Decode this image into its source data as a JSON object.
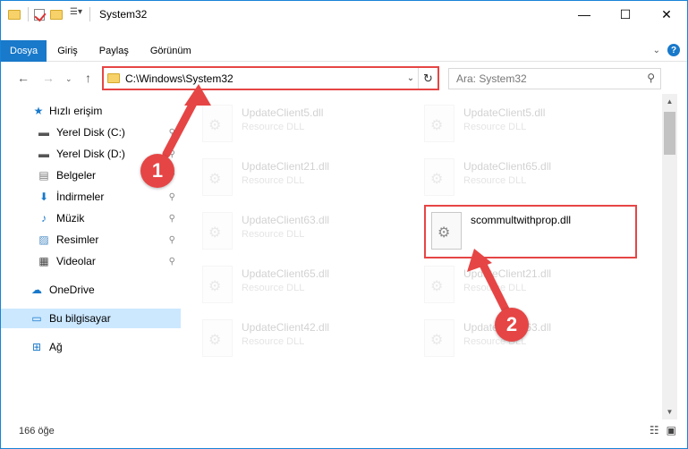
{
  "window": {
    "title": "System32",
    "controls": [
      "minimize",
      "maximize",
      "close"
    ]
  },
  "ribbon": {
    "tabs": [
      "Dosya",
      "Giriş",
      "Paylaş",
      "Görünüm"
    ],
    "active_tab": "Dosya",
    "help": "?"
  },
  "address": {
    "path": "C:\\Windows\\System32",
    "search_placeholder": "Ara: System32"
  },
  "nav": {
    "items": [
      {
        "label": "Hızlı erişim",
        "icon": "star-icon"
      },
      {
        "label": "Yerel Disk (C:)",
        "icon": "drive-icon"
      },
      {
        "label": "Yerel Disk (D:)",
        "icon": "drive-icon"
      },
      {
        "label": "Belgeler",
        "icon": "document-icon"
      },
      {
        "label": "İndirmeler",
        "icon": "download-icon"
      },
      {
        "label": "Müzik",
        "icon": "music-icon"
      },
      {
        "label": "Resimler",
        "icon": "picture-icon"
      },
      {
        "label": "Videolar",
        "icon": "video-icon"
      },
      {
        "label": "OneDrive",
        "icon": "cloud-icon"
      },
      {
        "label": "Bu bilgisayar",
        "icon": "computer-icon"
      },
      {
        "label": "Ağ",
        "icon": "network-icon"
      }
    ]
  },
  "files": [
    {
      "name": "UpdateClient5.dll",
      "type": "Resource DLL"
    },
    {
      "name": "UpdateClient5.dll",
      "type": "Resource DLL"
    },
    {
      "name": "UpdateClient21.dll",
      "type": "Resource DLL"
    },
    {
      "name": "UpdateClient65.dll",
      "type": "Resource DLL"
    },
    {
      "name": "UpdateClient63.dll",
      "type": "Resource DLL"
    },
    {
      "name": "scommultwithprop.dll",
      "type": ""
    },
    {
      "name": "UpdateClient65.dll",
      "type": "Resource DLL"
    },
    {
      "name": "UpdateClient21.dll",
      "type": "Resource DLL"
    },
    {
      "name": "UpdateClient42.dll",
      "type": "Resource DLL"
    },
    {
      "name": "UpdateClient63.dll",
      "type": "Resource DLL"
    }
  ],
  "status": {
    "count": "166 öğe"
  },
  "annotations": {
    "badge1": "1",
    "badge2": "2",
    "color": "#e64545"
  }
}
